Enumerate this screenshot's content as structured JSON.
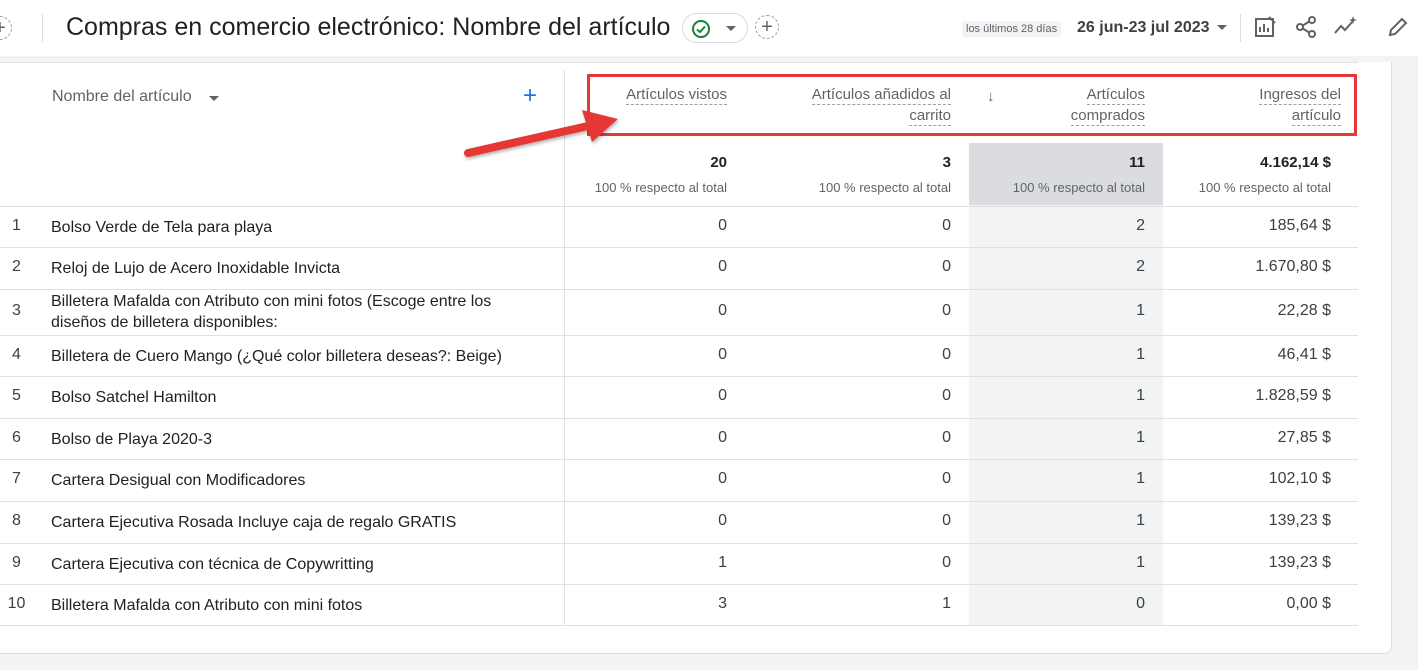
{
  "header": {
    "title": "Compras en comercio electrónico: Nombre del artículo",
    "range_label": "los últimos 28 días",
    "date_range": "26 jun-23 jul 2023"
  },
  "table": {
    "dimension_header": "Nombre del artículo",
    "add_symbol": "+",
    "sort_symbol": "↓",
    "metric_headers": [
      {
        "line1": "Artículos vistos",
        "line2": ""
      },
      {
        "line1": "Artículos añadidos al",
        "line2": "carrito"
      },
      {
        "line1": "Artículos",
        "line2": "comprados"
      },
      {
        "line1": "Ingresos del",
        "line2": "artículo"
      }
    ],
    "totals": [
      {
        "value": "20",
        "sub": "100 % respecto al total"
      },
      {
        "value": "3",
        "sub": "100 % respecto al total"
      },
      {
        "value": "11",
        "sub": "100 % respecto al total"
      },
      {
        "value": "4.162,14 $",
        "sub": "100 % respecto al total"
      }
    ],
    "rows": [
      {
        "idx": "1",
        "name": "Bolso Verde de Tela para playa",
        "vistos": "0",
        "anadidos": "0",
        "comprados": "2",
        "ingresos": "185,64 $"
      },
      {
        "idx": "2",
        "name": "Reloj de Lujo de Acero Inoxidable Invicta",
        "vistos": "0",
        "anadidos": "0",
        "comprados": "2",
        "ingresos": "1.670,80 $"
      },
      {
        "idx": "3",
        "name": "Billetera Mafalda con Atributo con mini fotos (Escoge entre los diseños de billetera disponibles:",
        "vistos": "0",
        "anadidos": "0",
        "comprados": "1",
        "ingresos": "22,28 $"
      },
      {
        "idx": "4",
        "name": "Billetera de Cuero Mango (¿Qué color billetera deseas?: Beige)",
        "vistos": "0",
        "anadidos": "0",
        "comprados": "1",
        "ingresos": "46,41 $"
      },
      {
        "idx": "5",
        "name": "Bolso Satchel Hamilton",
        "vistos": "0",
        "anadidos": "0",
        "comprados": "1",
        "ingresos": "1.828,59 $"
      },
      {
        "idx": "6",
        "name": "Bolso de Playa 2020-3",
        "vistos": "0",
        "anadidos": "0",
        "comprados": "1",
        "ingresos": "27,85 $"
      },
      {
        "idx": "7",
        "name": "Cartera Desigual con Modificadores",
        "vistos": "0",
        "anadidos": "0",
        "comprados": "1",
        "ingresos": "102,10 $"
      },
      {
        "idx": "8",
        "name": "Cartera Ejecutiva Rosada Incluye caja de regalo GRATIS",
        "vistos": "0",
        "anadidos": "0",
        "comprados": "1",
        "ingresos": "139,23 $"
      },
      {
        "idx": "9",
        "name": "Cartera Ejecutiva con técnica de Copywritting",
        "vistos": "1",
        "anadidos": "0",
        "comprados": "1",
        "ingresos": "139,23 $"
      },
      {
        "idx": "10",
        "name": "Billetera Mafalda con Atributo con mini fotos",
        "vistos": "3",
        "anadidos": "1",
        "comprados": "0",
        "ingresos": "0,00 $"
      }
    ]
  },
  "colors": {
    "accent": "#1a73e8",
    "annotation": "#e53935",
    "sorted_column": "#f1f3f4"
  }
}
